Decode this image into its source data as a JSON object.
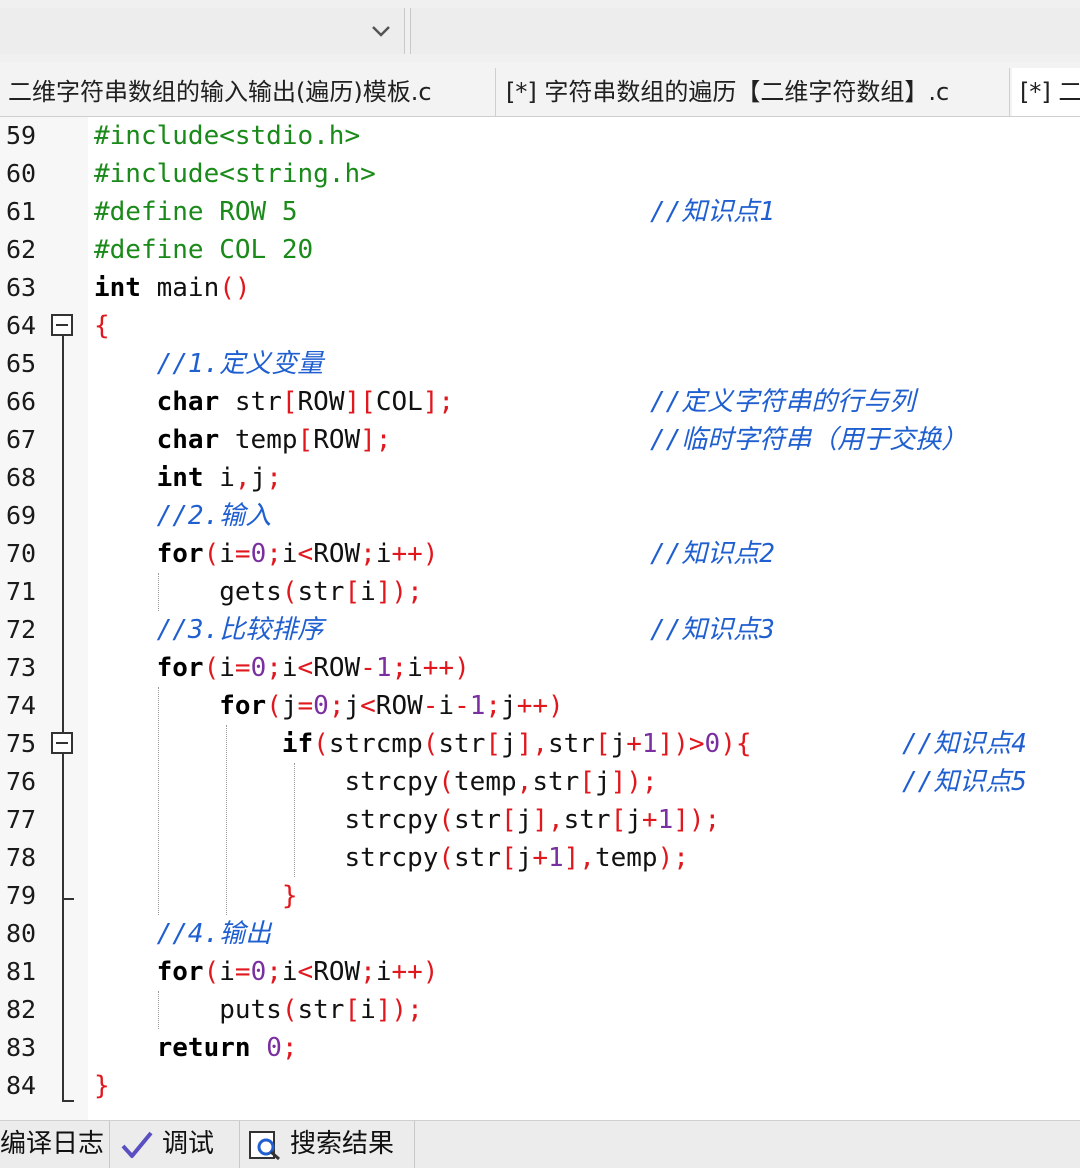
{
  "toolbar": {
    "dropdown_arrow": "chevron-down-icon"
  },
  "tabs": [
    {
      "label": "二维字符串数组的输入输出(遍历)模板.c"
    },
    {
      "label": "[*] 字符串数组的遍历【二维字符数组】.c"
    },
    {
      "label": "[*] 二"
    }
  ],
  "editor": {
    "lines": [
      {
        "n": "59",
        "code": [
          [
            "pp",
            "#include<stdio.h>"
          ]
        ],
        "comment": ""
      },
      {
        "n": "60",
        "code": [
          [
            "pp",
            "#include<string.h>"
          ]
        ],
        "comment": ""
      },
      {
        "n": "61",
        "code": [
          [
            "pp",
            "#define ROW 5"
          ]
        ],
        "comment": "//知识点1"
      },
      {
        "n": "62",
        "code": [
          [
            "pp",
            "#define COL 20"
          ]
        ],
        "comment": ""
      },
      {
        "n": "63",
        "code": [
          [
            "kw",
            "int"
          ],
          [
            "t",
            " main"
          ],
          [
            "op",
            "()"
          ]
        ],
        "comment": ""
      },
      {
        "n": "64",
        "code": [
          [
            "op",
            "{"
          ]
        ],
        "comment": ""
      },
      {
        "n": "65",
        "code": [
          [
            "cm",
            "    //1.定义变量"
          ]
        ],
        "comment": ""
      },
      {
        "n": "66",
        "code": [
          [
            "t",
            "    "
          ],
          [
            "kw",
            "char"
          ],
          [
            "t",
            " str"
          ],
          [
            "op",
            "["
          ],
          [
            "t",
            "ROW"
          ],
          [
            "op",
            "]["
          ],
          [
            "t",
            "COL"
          ],
          [
            "op",
            "];"
          ]
        ],
        "comment": "//定义字符串的行与列"
      },
      {
        "n": "67",
        "code": [
          [
            "t",
            "    "
          ],
          [
            "kw",
            "char"
          ],
          [
            "t",
            " temp"
          ],
          [
            "op",
            "["
          ],
          [
            "t",
            "ROW"
          ],
          [
            "op",
            "];"
          ]
        ],
        "comment": "//临时字符串（用于交换）"
      },
      {
        "n": "68",
        "code": [
          [
            "t",
            "    "
          ],
          [
            "kw",
            "int"
          ],
          [
            "t",
            " i"
          ],
          [
            "op",
            ","
          ],
          [
            "t",
            "j"
          ],
          [
            "op",
            ";"
          ]
        ],
        "comment": ""
      },
      {
        "n": "69",
        "code": [
          [
            "cm",
            "    //2.输入"
          ]
        ],
        "comment": ""
      },
      {
        "n": "70",
        "code": [
          [
            "t",
            "    "
          ],
          [
            "kw",
            "for"
          ],
          [
            "op",
            "("
          ],
          [
            "t",
            "i"
          ],
          [
            "op",
            "="
          ],
          [
            "num",
            "0"
          ],
          [
            "op",
            ";"
          ],
          [
            "t",
            "i"
          ],
          [
            "op",
            "<"
          ],
          [
            "t",
            "ROW"
          ],
          [
            "op",
            ";"
          ],
          [
            "t",
            "i"
          ],
          [
            "op",
            "++)"
          ]
        ],
        "comment": "//知识点2"
      },
      {
        "n": "71",
        "code": [
          [
            "t",
            "        gets"
          ],
          [
            "op",
            "("
          ],
          [
            "t",
            "str"
          ],
          [
            "op",
            "["
          ],
          [
            "t",
            "i"
          ],
          [
            "op",
            "]);"
          ]
        ],
        "comment": ""
      },
      {
        "n": "72",
        "code": [
          [
            "cm",
            "    //3.比较排序"
          ]
        ],
        "comment": "//知识点3"
      },
      {
        "n": "73",
        "code": [
          [
            "t",
            "    "
          ],
          [
            "kw",
            "for"
          ],
          [
            "op",
            "("
          ],
          [
            "t",
            "i"
          ],
          [
            "op",
            "="
          ],
          [
            "num",
            "0"
          ],
          [
            "op",
            ";"
          ],
          [
            "t",
            "i"
          ],
          [
            "op",
            "<"
          ],
          [
            "t",
            "ROW"
          ],
          [
            "op",
            "-"
          ],
          [
            "num",
            "1"
          ],
          [
            "op",
            ";"
          ],
          [
            "t",
            "i"
          ],
          [
            "op",
            "++)"
          ]
        ],
        "comment": ""
      },
      {
        "n": "74",
        "code": [
          [
            "t",
            "        "
          ],
          [
            "kw",
            "for"
          ],
          [
            "op",
            "("
          ],
          [
            "t",
            "j"
          ],
          [
            "op",
            "="
          ],
          [
            "num",
            "0"
          ],
          [
            "op",
            ";"
          ],
          [
            "t",
            "j"
          ],
          [
            "op",
            "<"
          ],
          [
            "t",
            "ROW"
          ],
          [
            "op",
            "-"
          ],
          [
            "t",
            "i"
          ],
          [
            "op",
            "-"
          ],
          [
            "num",
            "1"
          ],
          [
            "op",
            ";"
          ],
          [
            "t",
            "j"
          ],
          [
            "op",
            "++)"
          ]
        ],
        "comment": ""
      },
      {
        "n": "75",
        "code": [
          [
            "t",
            "            "
          ],
          [
            "kw",
            "if"
          ],
          [
            "op",
            "("
          ],
          [
            "t",
            "strcmp"
          ],
          [
            "op",
            "("
          ],
          [
            "t",
            "str"
          ],
          [
            "op",
            "["
          ],
          [
            "t",
            "j"
          ],
          [
            "op",
            "],"
          ],
          [
            "t",
            "str"
          ],
          [
            "op",
            "["
          ],
          [
            "t",
            "j"
          ],
          [
            "op",
            "+"
          ],
          [
            "num",
            "1"
          ],
          [
            "op",
            "])>"
          ],
          [
            "num",
            "0"
          ],
          [
            "op",
            "){"
          ]
        ],
        "comment": "//知识点4"
      },
      {
        "n": "76",
        "code": [
          [
            "t",
            "                strcpy"
          ],
          [
            "op",
            "("
          ],
          [
            "t",
            "temp"
          ],
          [
            "op",
            ","
          ],
          [
            "t",
            "str"
          ],
          [
            "op",
            "["
          ],
          [
            "t",
            "j"
          ],
          [
            "op",
            "]);"
          ]
        ],
        "comment": "//知识点5"
      },
      {
        "n": "77",
        "code": [
          [
            "t",
            "                strcpy"
          ],
          [
            "op",
            "("
          ],
          [
            "t",
            "str"
          ],
          [
            "op",
            "["
          ],
          [
            "t",
            "j"
          ],
          [
            "op",
            "],"
          ],
          [
            "t",
            "str"
          ],
          [
            "op",
            "["
          ],
          [
            "t",
            "j"
          ],
          [
            "op",
            "+"
          ],
          [
            "num",
            "1"
          ],
          [
            "op",
            "]);"
          ]
        ],
        "comment": ""
      },
      {
        "n": "78",
        "code": [
          [
            "t",
            "                strcpy"
          ],
          [
            "op",
            "("
          ],
          [
            "t",
            "str"
          ],
          [
            "op",
            "["
          ],
          [
            "t",
            "j"
          ],
          [
            "op",
            "+"
          ],
          [
            "num",
            "1"
          ],
          [
            "op",
            "],"
          ],
          [
            "t",
            "temp"
          ],
          [
            "op",
            ");"
          ]
        ],
        "comment": ""
      },
      {
        "n": "79",
        "code": [
          [
            "t",
            "            "
          ],
          [
            "op",
            "}"
          ]
        ],
        "comment": ""
      },
      {
        "n": "80",
        "code": [
          [
            "cm",
            "    //4.输出"
          ]
        ],
        "comment": ""
      },
      {
        "n": "81",
        "code": [
          [
            "t",
            "    "
          ],
          [
            "kw",
            "for"
          ],
          [
            "op",
            "("
          ],
          [
            "t",
            "i"
          ],
          [
            "op",
            "="
          ],
          [
            "num",
            "0"
          ],
          [
            "op",
            ";"
          ],
          [
            "t",
            "i"
          ],
          [
            "op",
            "<"
          ],
          [
            "t",
            "ROW"
          ],
          [
            "op",
            ";"
          ],
          [
            "t",
            "i"
          ],
          [
            "op",
            "++)"
          ]
        ],
        "comment": ""
      },
      {
        "n": "82",
        "code": [
          [
            "t",
            "        puts"
          ],
          [
            "op",
            "("
          ],
          [
            "t",
            "str"
          ],
          [
            "op",
            "["
          ],
          [
            "t",
            "i"
          ],
          [
            "op",
            "]);"
          ]
        ],
        "comment": ""
      },
      {
        "n": "83",
        "code": [
          [
            "t",
            "    "
          ],
          [
            "kw",
            "return"
          ],
          [
            "t",
            " "
          ],
          [
            "num",
            "0"
          ],
          [
            "op",
            ";"
          ]
        ],
        "comment": ""
      },
      {
        "n": "84",
        "code": [
          [
            "op",
            "}"
          ]
        ],
        "comment": ""
      }
    ]
  },
  "bottom_tabs": [
    {
      "label": "编译日志",
      "icon": ""
    },
    {
      "label": "调试",
      "icon": "checkmark-icon"
    },
    {
      "label": "搜索结果",
      "icon": "search-results-icon"
    }
  ],
  "colors": {
    "preprocessor": "#1a8a1a",
    "keyword": "#000000",
    "operator": "#e0181e",
    "number": "#7a2fa0",
    "comment": "#1f5fd0"
  }
}
